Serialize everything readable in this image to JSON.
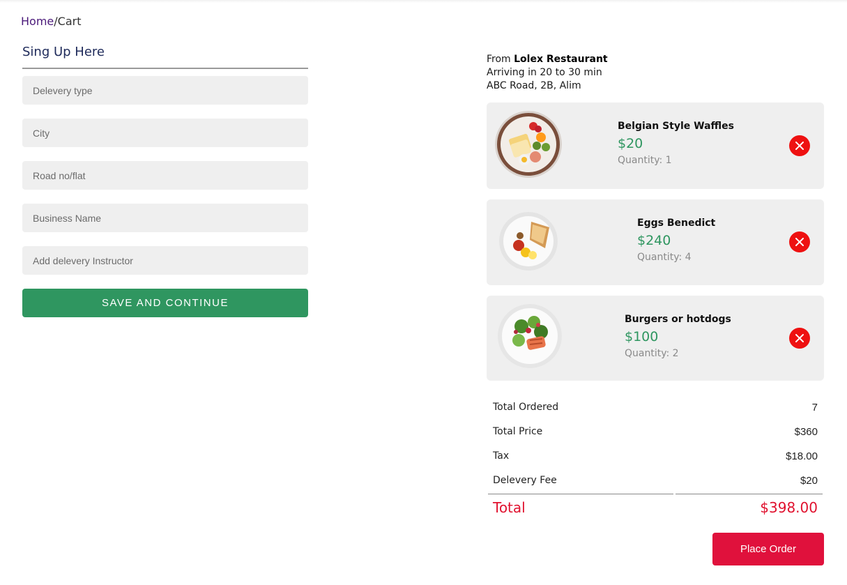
{
  "breadcrumb": {
    "home": "Home",
    "separator": "/",
    "current": "Cart"
  },
  "form": {
    "title": "Sing Up Here",
    "fields": [
      {
        "placeholder": "Delevery type",
        "value": ""
      },
      {
        "placeholder": "City",
        "value": ""
      },
      {
        "placeholder": "Road no/flat",
        "value": ""
      },
      {
        "placeholder": "Business Name",
        "value": ""
      },
      {
        "placeholder": "Add delevery Instructor",
        "value": ""
      }
    ],
    "submit_label": "SAVE AND CONTINUE"
  },
  "order": {
    "from_prefix": "From",
    "restaurant": "Lolex Restaurant",
    "arrival": "Arriving in 20 to 30 min",
    "address": "ABC Road, 2B, Alim"
  },
  "items": [
    {
      "name": "Belgian Style Waffles",
      "price": "$20",
      "quantity": "Quantity: 1",
      "image_icon": "breakfast-plate-icon"
    },
    {
      "name": "Eggs Benedict",
      "price": "$240",
      "quantity": "Quantity: 4",
      "image_icon": "toast-eggs-plate-icon"
    },
    {
      "name": "Burgers or hotdogs",
      "price": "$100",
      "quantity": "Quantity: 2",
      "image_icon": "salmon-salad-plate-icon"
    }
  ],
  "summary": {
    "rows": [
      {
        "label": "Total Ordered",
        "value": "7"
      },
      {
        "label": "Total Price",
        "value": "$360"
      },
      {
        "label": "Tax",
        "value": "$18.00"
      },
      {
        "label": "Delevery Fee",
        "value": "$20"
      }
    ],
    "total_label": "Total",
    "total_value": "$398.00"
  },
  "place_order_label": "Place Order",
  "colors": {
    "accent_green": "#2f9660",
    "accent_red": "#e0112e",
    "remove_red": "#ee1111",
    "breadcrumb_link": "#4b1a7a",
    "card_bg": "#efefef"
  }
}
